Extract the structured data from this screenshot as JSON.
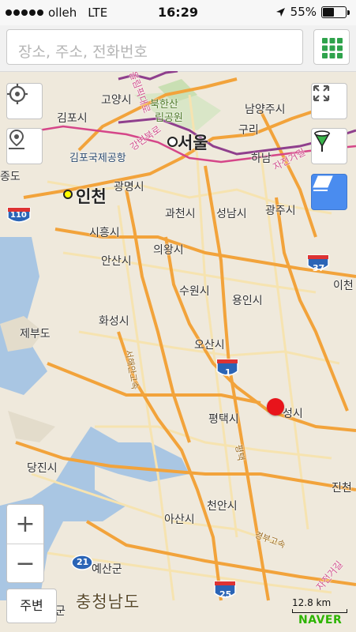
{
  "status_bar": {
    "carrier": "olleh",
    "network": "LTE",
    "time": "16:29",
    "battery": "55%",
    "battery_level": 0.55
  },
  "search": {
    "placeholder": "장소, 주소, 전화번호"
  },
  "map": {
    "cities": {
      "seoul": "서울",
      "incheon": "인천",
      "gimpo": "김포시",
      "goyang": "고양시",
      "gimpo_airport": "김포국제공항",
      "bukhansan": "북한산",
      "park": "립공원",
      "namyangju": "남양주시",
      "guri": "구리",
      "hanam": "하남",
      "gwangmyeong": "광명시",
      "gwacheon": "과천시",
      "seongnam": "성남시",
      "gwangju": "광주시",
      "siheung": "시흥시",
      "uiwang": "의왕시",
      "ansan": "안산시",
      "suwon": "수원시",
      "yongin": "용인시",
      "hwaseong": "화성시",
      "osan": "오산시",
      "pyeongtaek": "평택시",
      "anseong": "성시",
      "icheon": "이천",
      "dangjin": "당진시",
      "cheonan": "천안시",
      "asan": "아산시",
      "yesan": "예산군",
      "jincheon": "진천",
      "jebudo": "제부도",
      "yeongjongdo": "종도",
      "chungnam": "충청남도",
      "gun": "군"
    },
    "roads": {
      "r1": "경부고속",
      "r2": "서해안고속",
      "r3": "평택",
      "r4": "올림픽대로",
      "r5": "강변북로",
      "r6": "외곽순환",
      "r7": "자전거길",
      "r8": "중부고속"
    },
    "shields": {
      "i1": "1",
      "i21": "21",
      "i25": "25",
      "i37": "37",
      "i110": "110"
    }
  },
  "controls": {
    "zoom_in": "+",
    "zoom_out": "−",
    "around": "주변"
  },
  "scale": {
    "label": "12.8 km"
  },
  "brand": "NAVER"
}
